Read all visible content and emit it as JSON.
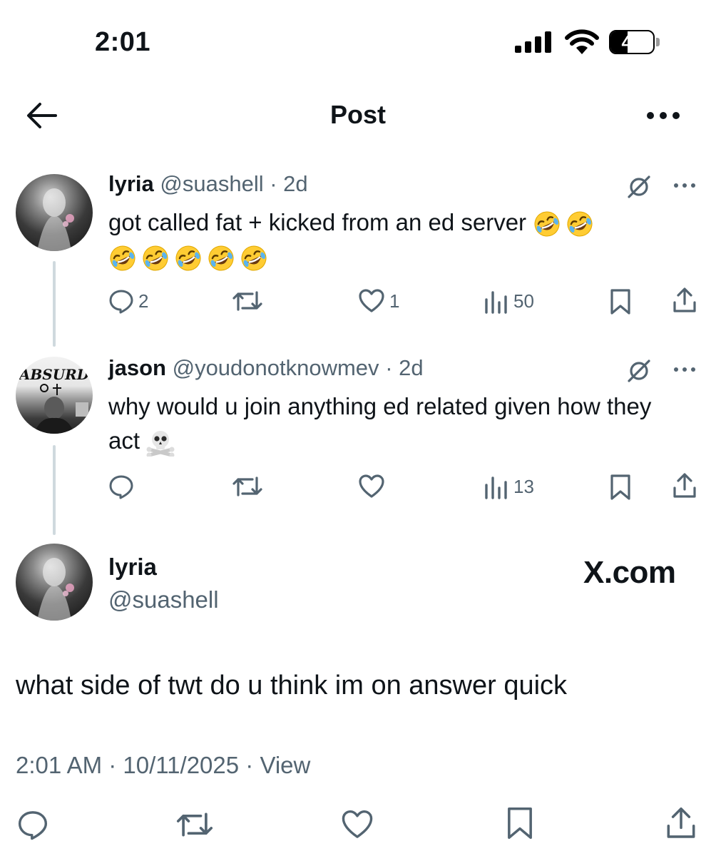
{
  "status_bar": {
    "time": "2:01",
    "battery": "40",
    "battery_level": 0.4
  },
  "header": {
    "title": "Post"
  },
  "thread": [
    {
      "name": "lyria",
      "handle": "@suashell",
      "age": "· 2d",
      "text_line1": "got called fat + kicked from an ed server",
      "emoji": "rolling-on-floor-laughing",
      "emoji_count_line1": 2,
      "emoji_count_line2": 5,
      "replies": "2",
      "reposts": "",
      "likes": "1",
      "views": "50"
    },
    {
      "name": "jason",
      "handle": "@youdonotknowmev",
      "age": "· 2d",
      "avatar_logo": "ABSURD",
      "text": "why would u join anything ed related given how they act",
      "emoji": "skull-and-crossbones",
      "replies": "",
      "reposts": "",
      "likes": "",
      "views": "13"
    }
  ],
  "main_post": {
    "name": "lyria",
    "handle": "@suashell",
    "watermark": "X.com",
    "text": "what side of twt do u think im on answer quick",
    "meta": "2:01 AM · 10/11/2025 · View"
  },
  "colors": {
    "text": "#0f1419",
    "secondary": "#536471",
    "thread_line": "#cfd9de"
  }
}
